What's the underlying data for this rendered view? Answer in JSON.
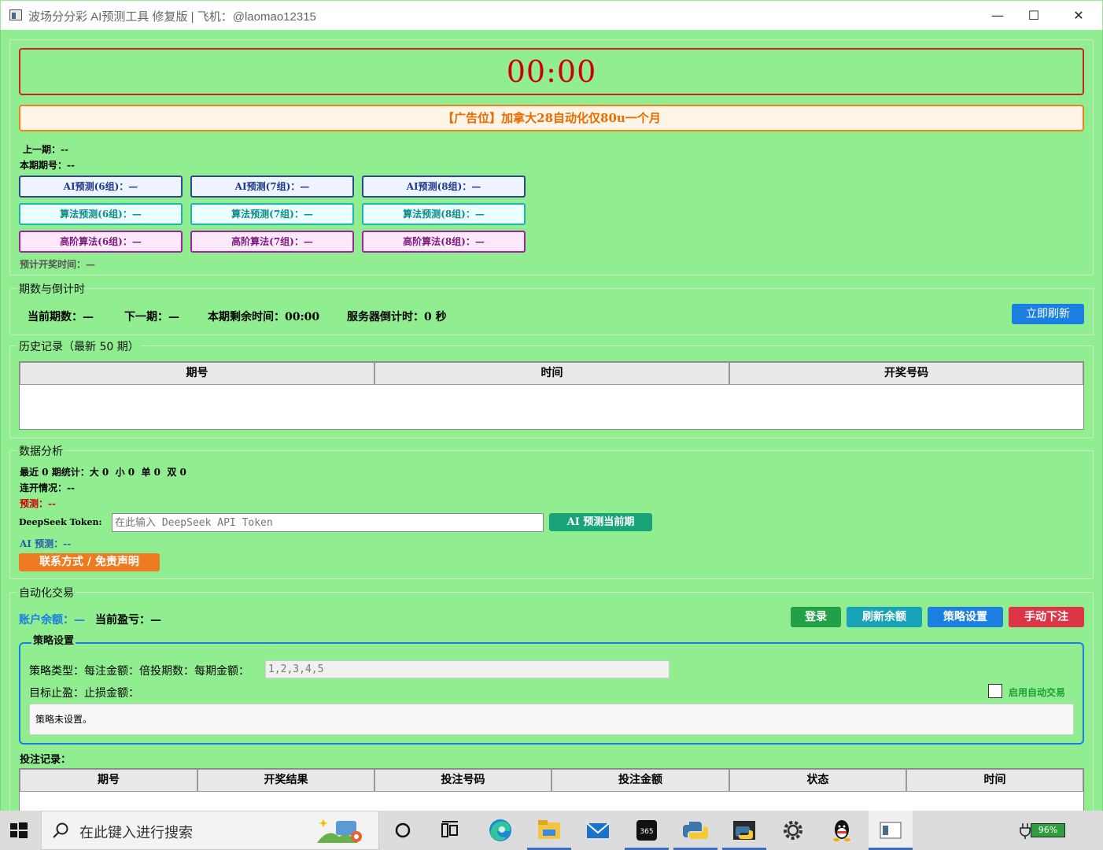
{
  "window": {
    "title": "波场分分彩 AI预测工具 修复版 | 飞机：@laomao12315",
    "min_label": "—",
    "max_label": "☐",
    "close_label": "✕"
  },
  "timer": "00:00",
  "ad": "【广告位】加拿大28自动化仅80u一个月",
  "info": {
    "last_label": "上一期：--",
    "current_label": "本期期号：--"
  },
  "predictions": {
    "ai": [
      "AI预测(6组)：—",
      "AI预测(7组)：—",
      "AI预测(8组)：—"
    ],
    "alg": [
      "算法预测(6组)：—",
      "算法预测(7组)：—",
      "算法预测(8组)：—"
    ],
    "adv": [
      "高阶算法(6组)：—",
      "高阶算法(7组)：—",
      "高阶算法(8组)：—"
    ]
  },
  "expected_time": "预计开奖时间：—",
  "period_section": {
    "title": "期数与倒计时",
    "current_period": "当前期数：—",
    "next_period": "下一期：—",
    "remaining": "本期剩余时间：00:00",
    "server_countdown": "服务器倒计时：0 秒",
    "refresh_btn": "立即刷新"
  },
  "history": {
    "title": "历史记录（最新 50 期）",
    "columns": [
      "期号",
      "时间",
      "开奖号码"
    ]
  },
  "analysis": {
    "title": "数据分析",
    "stats": "最近 0 期统计：大 0  小 0  单 0  双 0",
    "streak": "连开情况：--",
    "prediction": "预测：--",
    "token_label": "DeepSeek Token:",
    "token_placeholder": "在此输入 DeepSeek API Token",
    "ai_predict_btn": "AI 预测当前期",
    "ai_result": "AI 预测：--",
    "contact_btn": "联系方式 / 免责声明"
  },
  "trading": {
    "title": "自动化交易",
    "balance_label": "账户余额：—",
    "pnl_label": "当前盈亏：—",
    "login_btn": "登录",
    "refresh_balance_btn": "刷新余额",
    "strategy_btn": "策略设置",
    "manual_btn": "手动下注",
    "strategy_box_title": "策略设置",
    "strategy_line1": "策略类型：每注金额：倍投期数：每期金额：",
    "amounts_value": "1,2,3,4,5",
    "strategy_line2": "目标止盈：止损金额：",
    "auto_trade_label": "启用自动交易",
    "strategy_status": "策略未设置。",
    "bet_record_title": "投注记录：",
    "bet_columns": [
      "期号",
      "开奖结果",
      "投注号码",
      "投注金额",
      "状态",
      "时间"
    ]
  },
  "taskbar": {
    "search_placeholder": "在此键入进行搜索",
    "battery": "96%",
    "icons": [
      "windows-start-icon",
      "search-icon",
      "cortana-icon",
      "task-view-icon",
      "edge-icon",
      "file-explorer-icon",
      "mail-icon",
      "bet365-icon",
      "python-icon",
      "python-ide-icon",
      "settings-icon",
      "qq-icon",
      "app-window-icon"
    ]
  }
}
